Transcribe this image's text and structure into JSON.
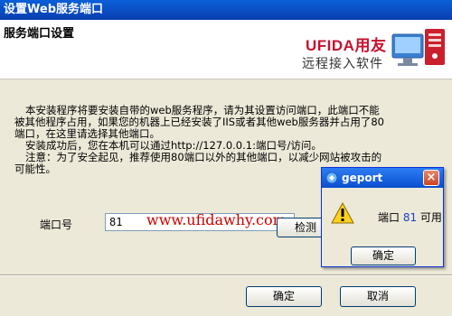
{
  "window": {
    "title": "设置Web服务端口"
  },
  "header": {
    "section_title": "服务端口设置",
    "brand_logo": "UFIDA用友",
    "brand_tagline": "远程接入软件"
  },
  "intro": {
    "line1": "本安装程序将要安装自带的web服务程序，请为其设置访问端口，此端口不能",
    "line2": "被其他程序占用，如果您的机器上已经安装了IIS或者其他web服务器并占用了80",
    "line3": "端口，在这里请选择其他端口。",
    "line4": "安装成功后，您在本机可以通过http://127.0.0.1:端口号/访问。",
    "line5": "注意：为了安全起见，推荐使用80端口以外的其他端口，以减少网站被攻击的",
    "line6": "可能性。"
  },
  "port": {
    "label": "端口号",
    "value": "81"
  },
  "watermark": "www.ufidawhy.com",
  "buttons": {
    "check": "检测",
    "ok": "确定",
    "cancel": "取消"
  },
  "dialog": {
    "title": "geport",
    "message_prefix": "端口 ",
    "port_value": "81",
    "message_suffix": " 可用",
    "ok": "确定",
    "close_glyph": "×"
  },
  "icons": {
    "dialog_app": "geport-app-icon",
    "warning": "warning-icon",
    "close": "close-icon",
    "brand_graphic": "brand-graphic"
  },
  "colors": {
    "titlebar": "#0a4ed0",
    "window_bg": "#ece9d8",
    "brand_red": "#c8102e",
    "watermark_red": "#cc0000",
    "port_value_blue": "#1a40c8"
  }
}
